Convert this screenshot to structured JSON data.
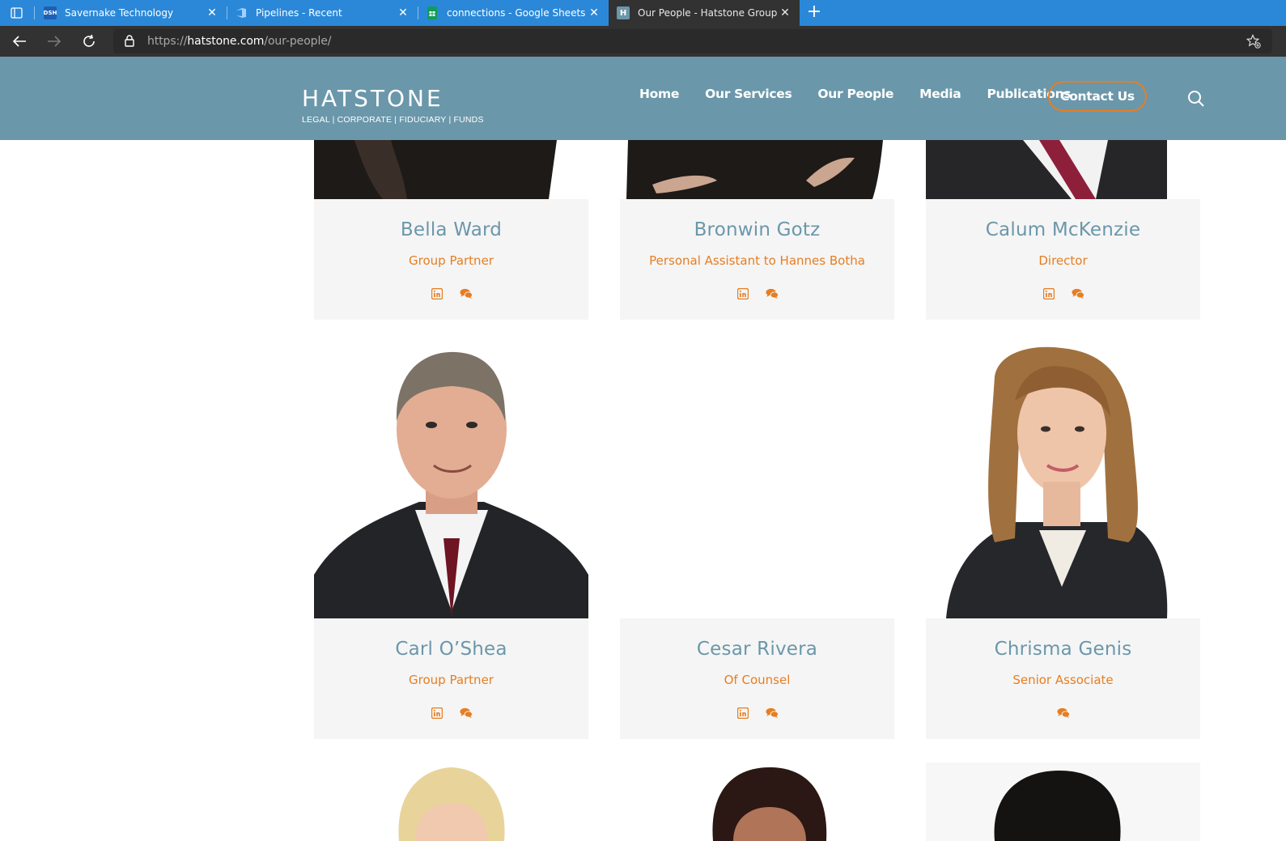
{
  "browser": {
    "tabs": [
      {
        "favicon": "DSH",
        "title": "Savernake Technology",
        "active": false
      },
      {
        "favicon": "azure-devops-icon",
        "title": "Pipelines - Recent",
        "active": false
      },
      {
        "favicon": "google-sheets-icon",
        "title": "connections - Google Sheets",
        "active": false
      },
      {
        "favicon": "H",
        "title": "Our People - Hatstone Group",
        "active": true
      }
    ],
    "url_prefix": "https://",
    "url_domain": "hatstone.com",
    "url_path": "/our-people/"
  },
  "site": {
    "logo_text": "HATSTONE",
    "logo_tagline": "LEGAL | CORPORATE | FIDUCIARY | FUNDS",
    "nav": [
      "Home",
      "Our Services",
      "Our People",
      "Media",
      "Publications"
    ],
    "contact_label": "Contact Us"
  },
  "people": [
    {
      "name": "Bella Ward",
      "role": "Group Partner",
      "linkedin": true,
      "message": true
    },
    {
      "name": "Bronwin Gotz",
      "role": "Personal Assistant to Hannes Botha",
      "linkedin": true,
      "message": true
    },
    {
      "name": "Calum McKenzie",
      "role": "Director",
      "linkedin": true,
      "message": true
    },
    {
      "name": "Carl O’Shea",
      "role": "Group Partner",
      "linkedin": true,
      "message": true
    },
    {
      "name": "Cesar Rivera",
      "role": "Of Counsel",
      "linkedin": true,
      "message": true
    },
    {
      "name": "Chrisma Genis",
      "role": "Senior Associate",
      "linkedin": false,
      "message": true
    }
  ],
  "colors": {
    "header_bg": "#6b97aa",
    "accent": "#e67e22",
    "name_color": "#6b97aa",
    "card_bg": "#f5f5f5",
    "tabbar_bg": "#2b88d8"
  }
}
